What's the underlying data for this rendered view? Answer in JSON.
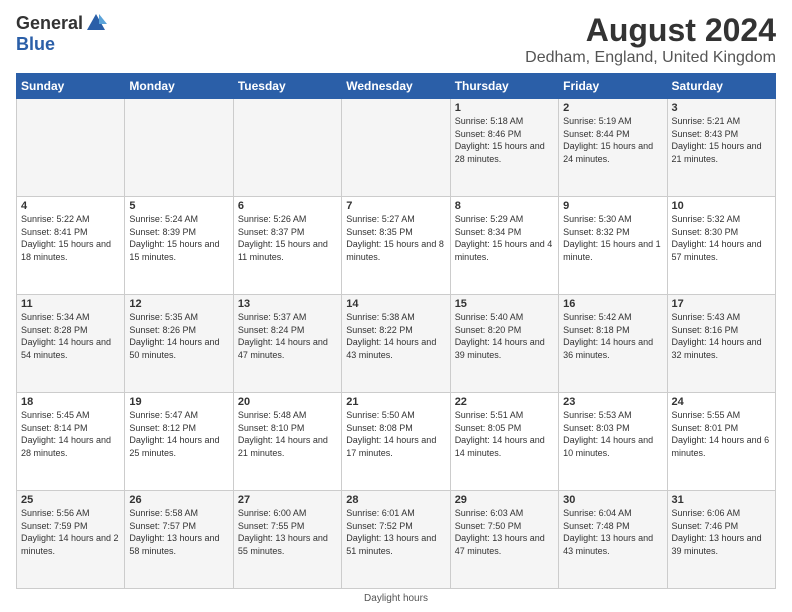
{
  "logo": {
    "general": "General",
    "blue": "Blue"
  },
  "title": "August 2024",
  "subtitle": "Dedham, England, United Kingdom",
  "headers": [
    "Sunday",
    "Monday",
    "Tuesday",
    "Wednesday",
    "Thursday",
    "Friday",
    "Saturday"
  ],
  "footer": "Daylight hours",
  "weeks": [
    [
      {
        "num": "",
        "info": ""
      },
      {
        "num": "",
        "info": ""
      },
      {
        "num": "",
        "info": ""
      },
      {
        "num": "",
        "info": ""
      },
      {
        "num": "1",
        "info": "Sunrise: 5:18 AM\nSunset: 8:46 PM\nDaylight: 15 hours\nand 28 minutes."
      },
      {
        "num": "2",
        "info": "Sunrise: 5:19 AM\nSunset: 8:44 PM\nDaylight: 15 hours\nand 24 minutes."
      },
      {
        "num": "3",
        "info": "Sunrise: 5:21 AM\nSunset: 8:43 PM\nDaylight: 15 hours\nand 21 minutes."
      }
    ],
    [
      {
        "num": "4",
        "info": "Sunrise: 5:22 AM\nSunset: 8:41 PM\nDaylight: 15 hours\nand 18 minutes."
      },
      {
        "num": "5",
        "info": "Sunrise: 5:24 AM\nSunset: 8:39 PM\nDaylight: 15 hours\nand 15 minutes."
      },
      {
        "num": "6",
        "info": "Sunrise: 5:26 AM\nSunset: 8:37 PM\nDaylight: 15 hours\nand 11 minutes."
      },
      {
        "num": "7",
        "info": "Sunrise: 5:27 AM\nSunset: 8:35 PM\nDaylight: 15 hours\nand 8 minutes."
      },
      {
        "num": "8",
        "info": "Sunrise: 5:29 AM\nSunset: 8:34 PM\nDaylight: 15 hours\nand 4 minutes."
      },
      {
        "num": "9",
        "info": "Sunrise: 5:30 AM\nSunset: 8:32 PM\nDaylight: 15 hours\nand 1 minute."
      },
      {
        "num": "10",
        "info": "Sunrise: 5:32 AM\nSunset: 8:30 PM\nDaylight: 14 hours\nand 57 minutes."
      }
    ],
    [
      {
        "num": "11",
        "info": "Sunrise: 5:34 AM\nSunset: 8:28 PM\nDaylight: 14 hours\nand 54 minutes."
      },
      {
        "num": "12",
        "info": "Sunrise: 5:35 AM\nSunset: 8:26 PM\nDaylight: 14 hours\nand 50 minutes."
      },
      {
        "num": "13",
        "info": "Sunrise: 5:37 AM\nSunset: 8:24 PM\nDaylight: 14 hours\nand 47 minutes."
      },
      {
        "num": "14",
        "info": "Sunrise: 5:38 AM\nSunset: 8:22 PM\nDaylight: 14 hours\nand 43 minutes."
      },
      {
        "num": "15",
        "info": "Sunrise: 5:40 AM\nSunset: 8:20 PM\nDaylight: 14 hours\nand 39 minutes."
      },
      {
        "num": "16",
        "info": "Sunrise: 5:42 AM\nSunset: 8:18 PM\nDaylight: 14 hours\nand 36 minutes."
      },
      {
        "num": "17",
        "info": "Sunrise: 5:43 AM\nSunset: 8:16 PM\nDaylight: 14 hours\nand 32 minutes."
      }
    ],
    [
      {
        "num": "18",
        "info": "Sunrise: 5:45 AM\nSunset: 8:14 PM\nDaylight: 14 hours\nand 28 minutes."
      },
      {
        "num": "19",
        "info": "Sunrise: 5:47 AM\nSunset: 8:12 PM\nDaylight: 14 hours\nand 25 minutes."
      },
      {
        "num": "20",
        "info": "Sunrise: 5:48 AM\nSunset: 8:10 PM\nDaylight: 14 hours\nand 21 minutes."
      },
      {
        "num": "21",
        "info": "Sunrise: 5:50 AM\nSunset: 8:08 PM\nDaylight: 14 hours\nand 17 minutes."
      },
      {
        "num": "22",
        "info": "Sunrise: 5:51 AM\nSunset: 8:05 PM\nDaylight: 14 hours\nand 14 minutes."
      },
      {
        "num": "23",
        "info": "Sunrise: 5:53 AM\nSunset: 8:03 PM\nDaylight: 14 hours\nand 10 minutes."
      },
      {
        "num": "24",
        "info": "Sunrise: 5:55 AM\nSunset: 8:01 PM\nDaylight: 14 hours\nand 6 minutes."
      }
    ],
    [
      {
        "num": "25",
        "info": "Sunrise: 5:56 AM\nSunset: 7:59 PM\nDaylight: 14 hours\nand 2 minutes."
      },
      {
        "num": "26",
        "info": "Sunrise: 5:58 AM\nSunset: 7:57 PM\nDaylight: 13 hours\nand 58 minutes."
      },
      {
        "num": "27",
        "info": "Sunrise: 6:00 AM\nSunset: 7:55 PM\nDaylight: 13 hours\nand 55 minutes."
      },
      {
        "num": "28",
        "info": "Sunrise: 6:01 AM\nSunset: 7:52 PM\nDaylight: 13 hours\nand 51 minutes."
      },
      {
        "num": "29",
        "info": "Sunrise: 6:03 AM\nSunset: 7:50 PM\nDaylight: 13 hours\nand 47 minutes."
      },
      {
        "num": "30",
        "info": "Sunrise: 6:04 AM\nSunset: 7:48 PM\nDaylight: 13 hours\nand 43 minutes."
      },
      {
        "num": "31",
        "info": "Sunrise: 6:06 AM\nSunset: 7:46 PM\nDaylight: 13 hours\nand 39 minutes."
      }
    ]
  ]
}
